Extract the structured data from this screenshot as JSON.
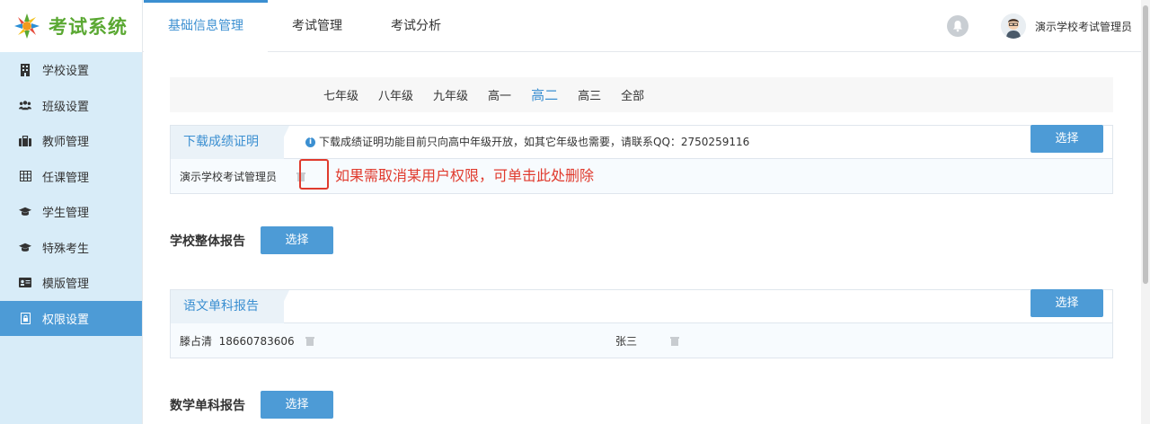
{
  "app": {
    "logo_text": "考试系统"
  },
  "nav": {
    "items": [
      {
        "label": "基础信息管理",
        "active": true
      },
      {
        "label": "考试管理",
        "active": false
      },
      {
        "label": "考试分析",
        "active": false
      }
    ]
  },
  "user": {
    "name": "演示学校考试管理员"
  },
  "sidebar": {
    "items": [
      {
        "label": "学校设置",
        "icon": "building-icon"
      },
      {
        "label": "班级设置",
        "icon": "group-icon"
      },
      {
        "label": "教师管理",
        "icon": "briefcase-icon"
      },
      {
        "label": "任课管理",
        "icon": "grid-icon"
      },
      {
        "label": "学生管理",
        "icon": "graduation-cap-icon"
      },
      {
        "label": "特殊考生",
        "icon": "graduation-cap-icon"
      },
      {
        "label": "模版管理",
        "icon": "id-card-icon"
      },
      {
        "label": "权限设置",
        "icon": "lock-file-icon",
        "active": true
      }
    ]
  },
  "grades": {
    "items": [
      "七年级",
      "八年级",
      "九年级",
      "高一",
      "高二",
      "高三",
      "全部"
    ],
    "active": "高二"
  },
  "certificate_panel": {
    "title": "下载成绩证明",
    "notice": "下载成绩证明功能目前只向高中年级开放，如其它年级也需要，请联系QQ：2750259116",
    "button": "选择",
    "user": "演示学校考试管理员",
    "hint": "如果需取消某用户权限，可单击此处删除"
  },
  "school_report": {
    "title": "学校整体报告",
    "button": "选择"
  },
  "chinese_panel": {
    "title": "语文单科报告",
    "button": "选择",
    "users": [
      "滕占清  18660783606",
      "张三"
    ]
  },
  "math_report": {
    "title": "数学单科报告",
    "button": "选择"
  },
  "colors": {
    "accent": "#3b8fd1",
    "button": "#4d9bd6",
    "sidebar": "#d8ecf8",
    "highlight": "#e03a2d",
    "logo": "#5aa832"
  }
}
